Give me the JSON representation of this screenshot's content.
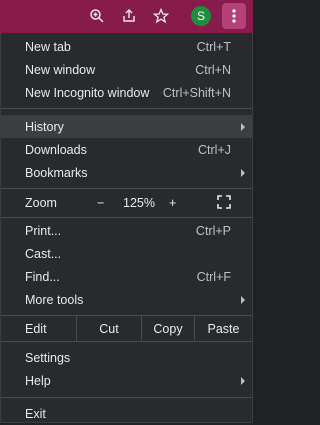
{
  "toolbar": {
    "zoom_icon": "zoom-in-icon",
    "share_icon": "share-icon",
    "bookmark_icon": "star-icon",
    "profile_initial": "S",
    "menu_icon": "three-dot-menu-icon"
  },
  "menu": {
    "new_tab": {
      "label": "New tab",
      "shortcut": "Ctrl+T"
    },
    "new_window": {
      "label": "New window",
      "shortcut": "Ctrl+N"
    },
    "new_incognito": {
      "label": "New Incognito window",
      "shortcut": "Ctrl+Shift+N"
    },
    "history": {
      "label": "History"
    },
    "downloads": {
      "label": "Downloads",
      "shortcut": "Ctrl+J"
    },
    "bookmarks": {
      "label": "Bookmarks"
    },
    "zoom": {
      "label": "Zoom",
      "minus": "−",
      "value": "125%",
      "plus": "+"
    },
    "print": {
      "label": "Print...",
      "shortcut": "Ctrl+P"
    },
    "cast": {
      "label": "Cast..."
    },
    "find": {
      "label": "Find...",
      "shortcut": "Ctrl+F"
    },
    "more_tools": {
      "label": "More tools"
    },
    "edit": {
      "label": "Edit",
      "cut": "Cut",
      "copy": "Copy",
      "paste": "Paste"
    },
    "settings": {
      "label": "Settings"
    },
    "help": {
      "label": "Help"
    },
    "exit": {
      "label": "Exit"
    }
  },
  "colors": {
    "toolbar_bg": "#861b4c",
    "menu_bg": "#292a2d",
    "highlight": "#3d3e42",
    "avatar": "#1e8e3e"
  }
}
